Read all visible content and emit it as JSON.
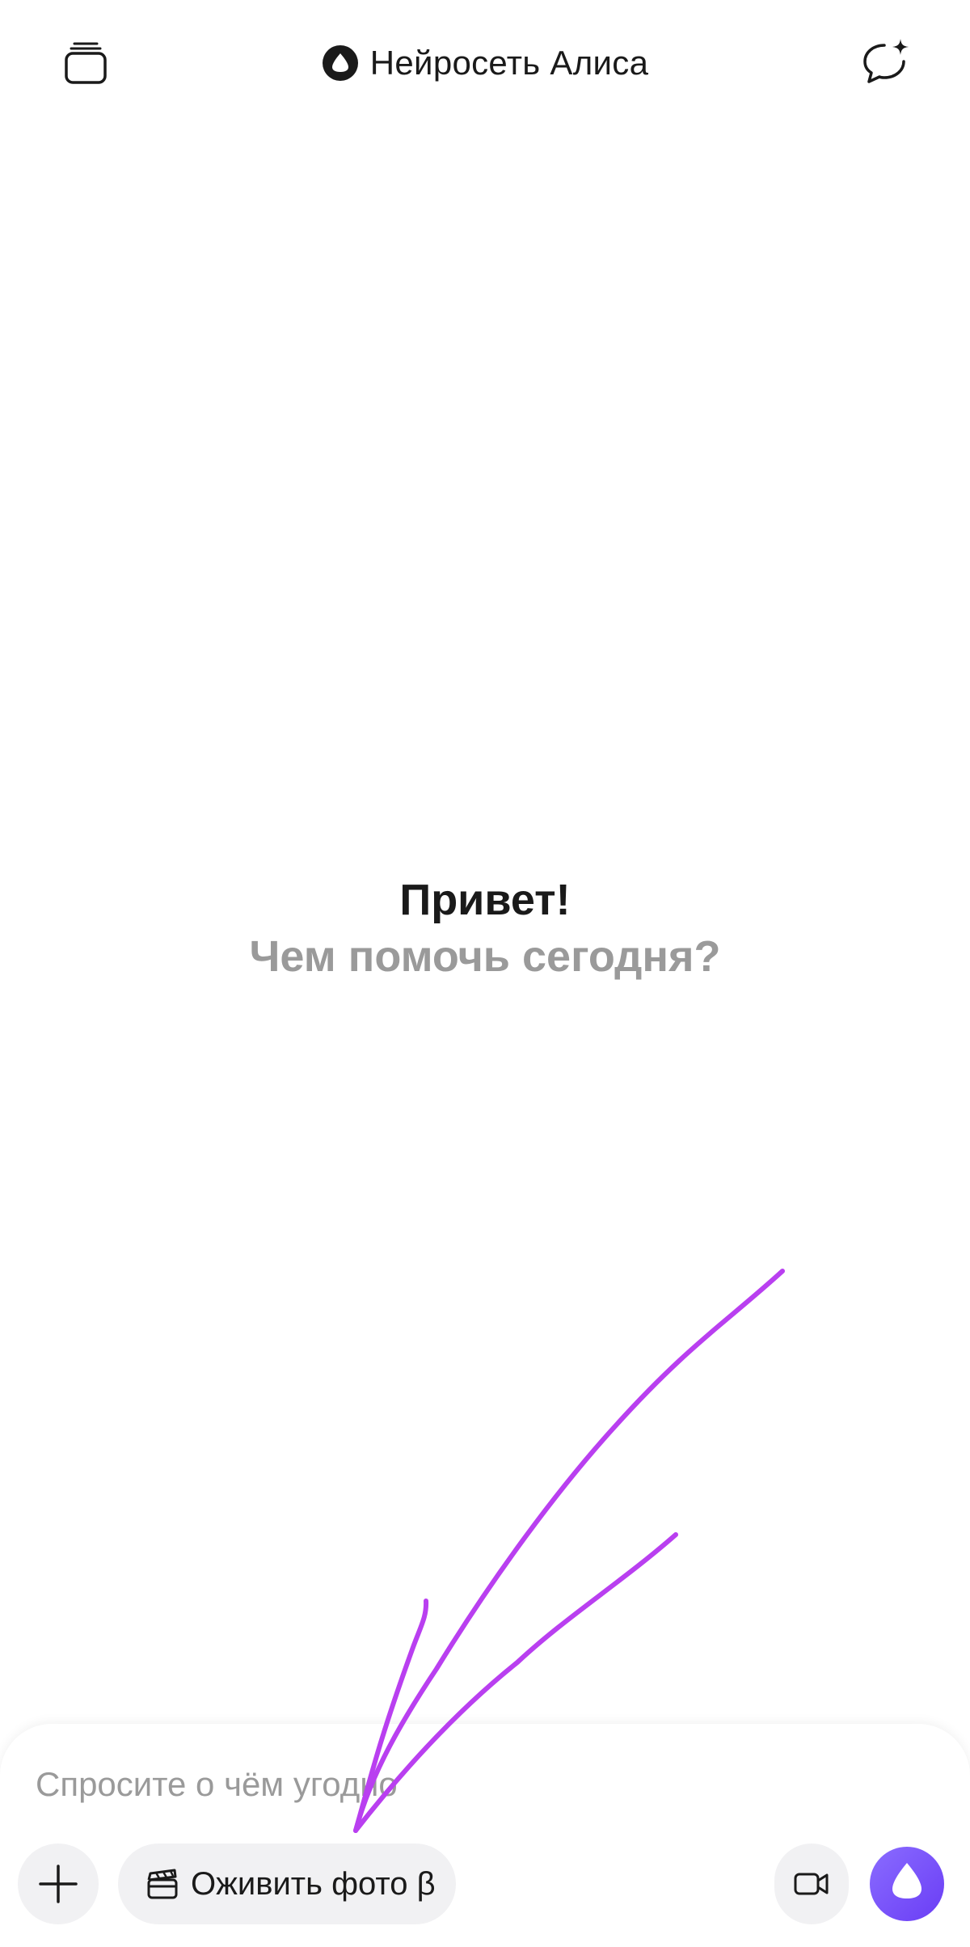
{
  "header": {
    "title": "Нейросеть Алиса",
    "history_icon": "stack-icon",
    "new_chat_icon": "chat-sparkle-icon"
  },
  "greeting": {
    "title": "Привет!",
    "subtitle": "Чем помочь сегодня?"
  },
  "composer": {
    "placeholder": "Спросите о чём угодно",
    "value": "",
    "plus_icon": "plus-icon",
    "chip_icon": "clapperboard-icon",
    "chip_label": "Оживить фото β",
    "video_icon": "video-camera-icon",
    "alice_icon": "alice-logo-icon"
  },
  "colors": {
    "text": "#1a1a1a",
    "muted": "#9a9a9a",
    "chip_bg": "#f1f1f3",
    "alice_gradient_start": "#8a6cff",
    "alice_gradient_end": "#6a3df5",
    "annotation": "#b93ff0"
  }
}
